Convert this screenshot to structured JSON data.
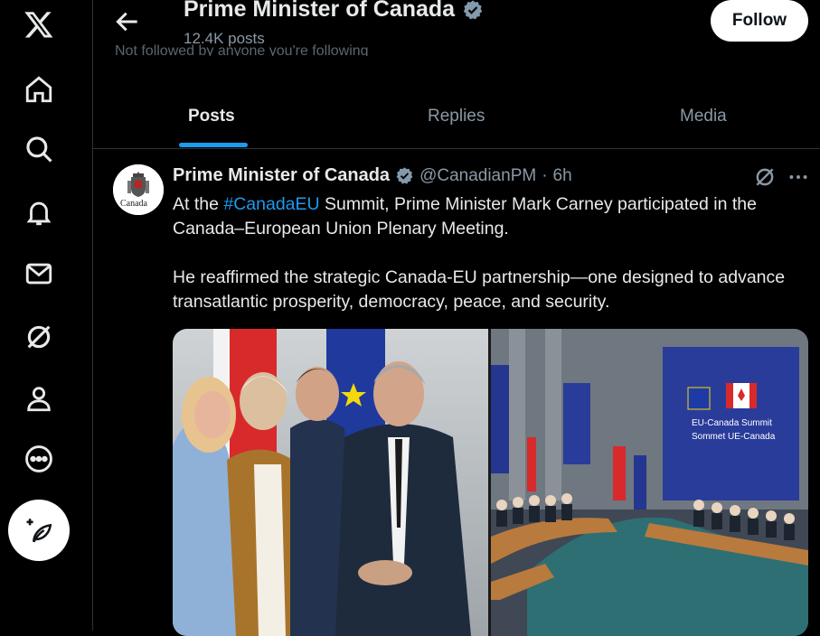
{
  "sidebar": {
    "items": [
      {
        "icon": "x-logo-icon"
      },
      {
        "icon": "home-icon"
      },
      {
        "icon": "search-icon"
      },
      {
        "icon": "bell-icon"
      },
      {
        "icon": "mail-icon"
      },
      {
        "icon": "grok-icon"
      },
      {
        "icon": "profile-icon"
      },
      {
        "icon": "more-circle-icon"
      }
    ],
    "compose_icon": "compose-post-icon"
  },
  "header": {
    "title": "Prime Minister of Canada",
    "post_count": "12.4K posts",
    "truncated_line": "Not followed by anyone you're following",
    "follow_label": "Follow"
  },
  "tabs": [
    {
      "label": "Posts",
      "active": true
    },
    {
      "label": "Replies",
      "active": false
    },
    {
      "label": "Media",
      "active": false
    }
  ],
  "post": {
    "author": "Prime Minister of Canada",
    "handle": "@CanadianPM",
    "separator": "·",
    "time": "6h",
    "avatar_text": "Canada",
    "text_part1_prefix": "At the ",
    "hashtag": "#CanadaEU",
    "text_part1_suffix": " Summit, Prime Minister Mark Carney participated in the Canada–European Union Plenary Meeting.",
    "text_part2": "He reaffirmed the strategic Canada-EU partnership—one designed to advance transatlantic prosperity, democracy, peace, and security.",
    "banner_title": "EU-Canada Summit",
    "banner_subtitle": "Sommet UE-Canada"
  },
  "colors": {
    "background": "#000000",
    "accent": "#1d9bf0",
    "text_primary": "#e7e9ea",
    "text_secondary": "#8b98a5",
    "divider": "#2f3336"
  }
}
